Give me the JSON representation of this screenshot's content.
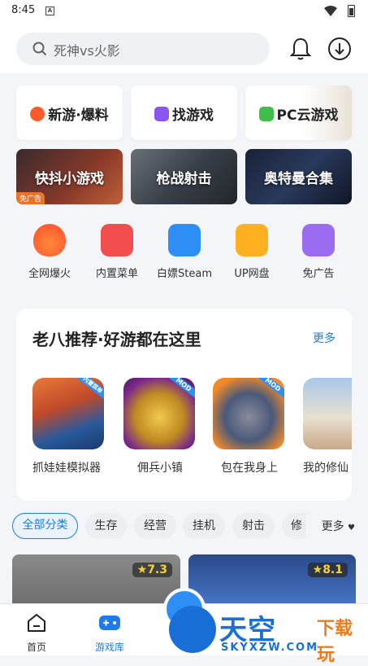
{
  "status": {
    "time": "8:45"
  },
  "search": {
    "placeholder": "死神vs火影"
  },
  "quick_cards": [
    {
      "label": "新游·爆料",
      "icon": "fire-icon",
      "color": "#ff5a2a"
    },
    {
      "label": "找游戏",
      "icon": "gamepad-icon",
      "color": "#8a55f0"
    },
    {
      "label": "PC云游戏",
      "icon": "monitor-icon",
      "color": "#3fbf4a"
    }
  ],
  "banner_cards": [
    {
      "label": "快抖小游戏",
      "tag": "免广告"
    },
    {
      "label": "枪战射击"
    },
    {
      "label": "奥特曼合集"
    }
  ],
  "icon_row": [
    {
      "label": "全网爆火",
      "icon": "flame-tiktok-icon",
      "color": "#ff6a2c"
    },
    {
      "label": "内置菜单",
      "icon": "menu-badge-icon",
      "color": "#f24e4e"
    },
    {
      "label": "白嫖Steam",
      "icon": "steam-monitor-icon",
      "color": "#2d8ff5"
    },
    {
      "label": "UP网盘",
      "icon": "up-cloud-icon",
      "color": "#ffb020"
    },
    {
      "label": "免广告",
      "icon": "ad-block-icon",
      "color": "#9b6cf2"
    }
  ],
  "recommend": {
    "title": "老八推荐·好游都在这里",
    "more": "更多",
    "games": [
      {
        "name": "抓娃娃模拟器",
        "badge": "内置菜单"
      },
      {
        "name": "佣兵小镇",
        "badge": "MOD"
      },
      {
        "name": "包在我身上",
        "badge": "MOD"
      },
      {
        "name": "我的修仙"
      }
    ]
  },
  "categories": {
    "items": [
      "全部分类",
      "生存",
      "经营",
      "挂机",
      "射击",
      "修"
    ],
    "more": "更多"
  },
  "tiles": [
    {
      "rating": "7.3"
    },
    {
      "rating": "8.1"
    }
  ],
  "bottom_nav": [
    {
      "label": "首页",
      "icon": "home-icon"
    },
    {
      "label": "游戏库",
      "icon": "gamepad-icon"
    }
  ],
  "watermark": {
    "title": "天空",
    "sub": "下载玩",
    "url": "SKYXZW.COM"
  }
}
